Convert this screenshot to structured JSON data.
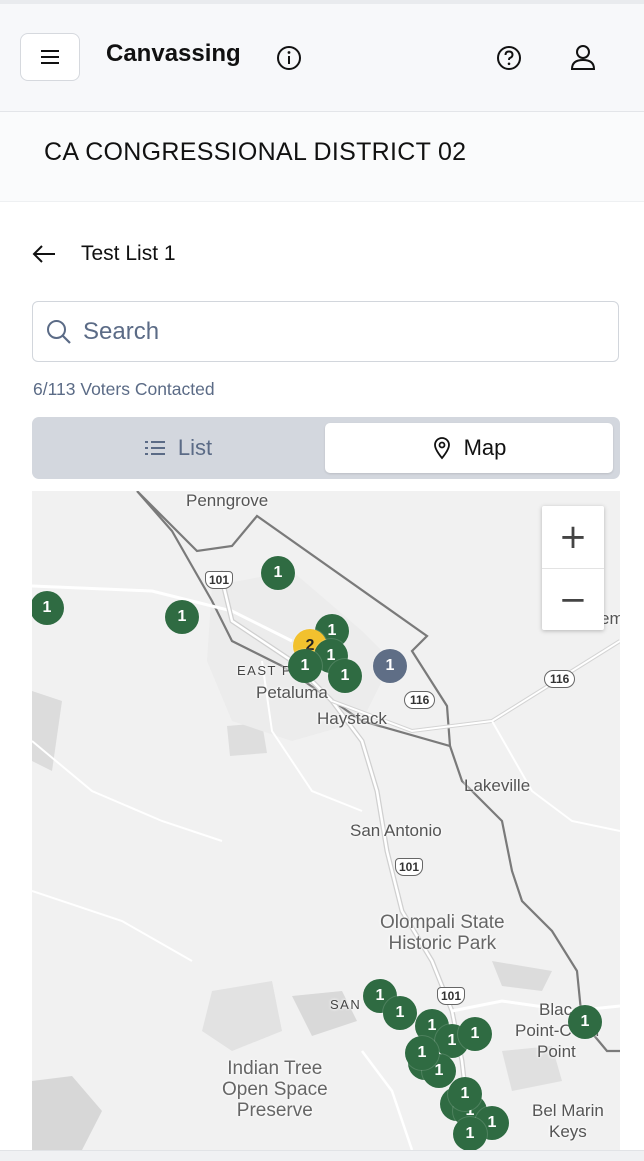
{
  "header": {
    "title": "Canvassing",
    "icons": [
      "menu-icon",
      "info-icon",
      "help-icon",
      "user-icon"
    ]
  },
  "district": {
    "title": "CA CONGRESSIONAL DISTRICT 02"
  },
  "list": {
    "name": "Test List 1",
    "back_icon": "arrow-left-icon"
  },
  "search": {
    "placeholder": "Search",
    "value": ""
  },
  "progress": {
    "text": "6/113 Voters Contacted",
    "contacted": 6,
    "total": 113
  },
  "view_toggle": {
    "list_label": "List",
    "map_label": "Map",
    "selected": "Map"
  },
  "map": {
    "zoom_in": "+",
    "zoom_out": "−",
    "places": {
      "penngrove": "Penngrove",
      "east_petaluma": "EAST P",
      "petaluma": "Petaluma",
      "haystack": "Haystack",
      "lakeville": "Lakeville",
      "san_antonio": "San Antonio",
      "olompali_1": "Olompali State",
      "olompali_2": "Historic Park",
      "san": "SAN",
      "indian_1": "Indian Tree",
      "indian_2": "Open Space",
      "indian_3": "Preserve",
      "black_1": "Blac",
      "black_2": "Point-C",
      "black_2b": "n",
      "black_3": "Point",
      "belmarin_1": "Bel Marin",
      "belmarin_2": "Keys",
      "edge_m": "em"
    },
    "highways": {
      "h101_a": "101",
      "h101_b": "101",
      "h101_c": "101",
      "h116_a": "116",
      "h116_b": "116"
    },
    "colors": {
      "green": "#2f6b42",
      "yellow": "#f2c12e",
      "slate": "#5f6e86"
    },
    "markers": [
      {
        "count": "1",
        "color": "green"
      },
      {
        "count": "1",
        "color": "green"
      },
      {
        "count": "1",
        "color": "green"
      },
      {
        "count": "1",
        "color": "green"
      },
      {
        "count": "2",
        "color": "yellow"
      },
      {
        "count": "1",
        "color": "green"
      },
      {
        "count": "1",
        "color": "green"
      },
      {
        "count": "1",
        "color": "green"
      },
      {
        "count": "1",
        "color": "slate"
      },
      {
        "count": "1",
        "color": "green"
      },
      {
        "count": "1",
        "color": "green"
      },
      {
        "count": "1",
        "color": "green"
      },
      {
        "count": "1",
        "color": "green"
      },
      {
        "count": "1",
        "color": "green"
      },
      {
        "count": "1",
        "color": "green"
      },
      {
        "count": "1",
        "color": "green"
      },
      {
        "count": "1",
        "color": "green"
      },
      {
        "count": "1",
        "color": "green"
      },
      {
        "count": "1",
        "color": "green"
      },
      {
        "count": "1",
        "color": "green"
      },
      {
        "count": "1",
        "color": "green"
      },
      {
        "count": "1",
        "color": "green"
      },
      {
        "count": "1",
        "color": "green"
      }
    ]
  }
}
